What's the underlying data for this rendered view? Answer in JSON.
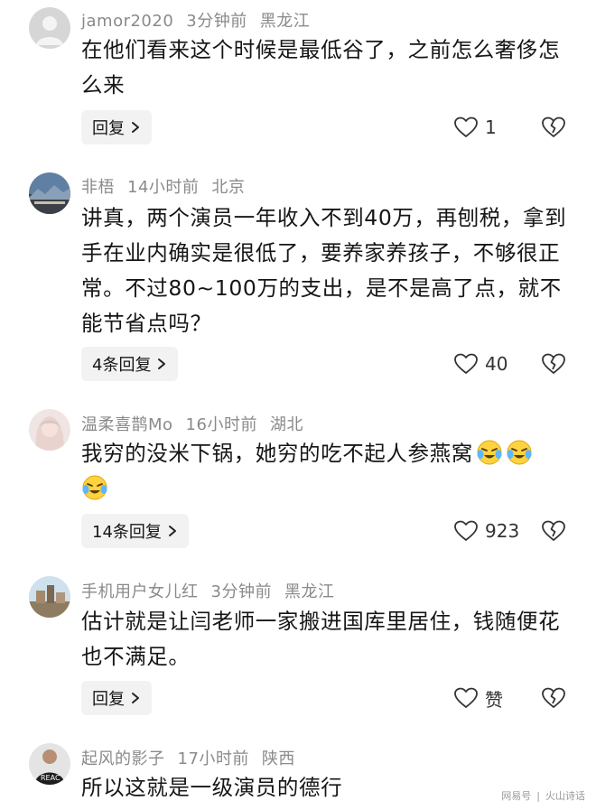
{
  "comments": [
    {
      "username": "jamor2020",
      "time": "3分钟前",
      "location": "黑龙江",
      "text": "在他们看来这个时候是最低谷了，之前怎么奢侈怎么来",
      "reply_label": "回复",
      "likes": "1"
    },
    {
      "username": "非梧",
      "time": "14小时前",
      "location": "北京",
      "text": "讲真，两个演员一年收入不到40万，再刨税，拿到手在业内确实是很低了，要养家养孩子，不够很正常。不过80~100万的支出，是不是高了点，就不能节省点吗？",
      "reply_label": "4条回复",
      "likes": "40"
    },
    {
      "username": "温柔喜鹊Mo",
      "time": "16小时前",
      "location": "湖北",
      "text": "我穷的没米下锅，她穷的吃不起人参燕窝",
      "emojis": [
        "crying-laugh-emoji",
        "crying-laugh-emoji",
        "crying-laugh-emoji"
      ],
      "reply_label": "14条回复",
      "likes": "923"
    },
    {
      "username": "手机用户女儿红",
      "time": "3分钟前",
      "location": "黑龙江",
      "text": "估计就是让闫老师一家搬进国库里居住，钱随便花也不满足。",
      "reply_label": "回复",
      "likes": "赞"
    },
    {
      "username": "起风的影子",
      "time": "17小时前",
      "location": "陕西",
      "text": "所以这就是一级演员的德行"
    }
  ],
  "watermark": {
    "left": "网易号",
    "right": "火山诗话"
  },
  "icons": {
    "like": "heart-outline-icon",
    "dislike": "broken-heart-icon",
    "reply_chevron": "chevron-right-icon"
  }
}
